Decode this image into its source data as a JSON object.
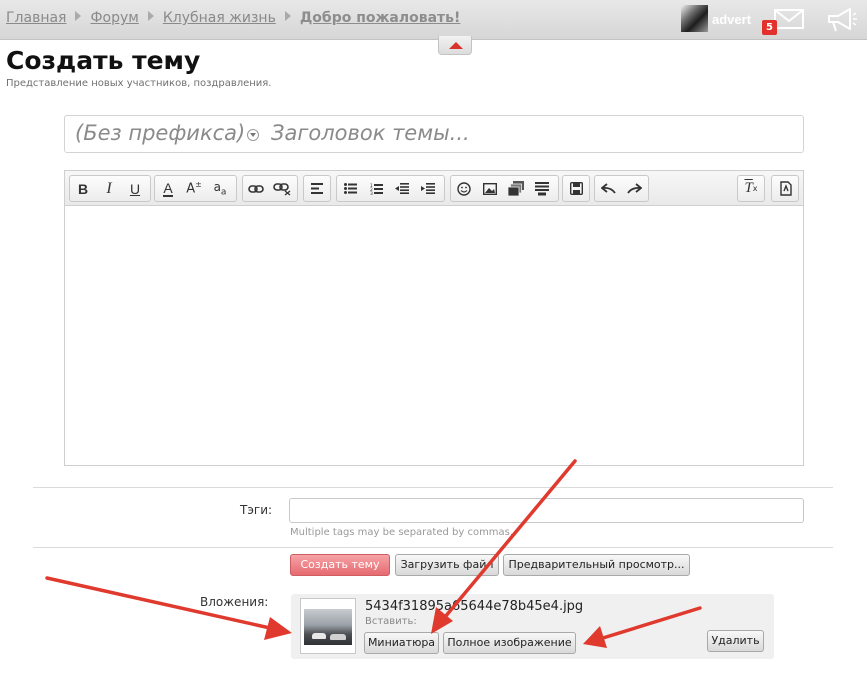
{
  "breadcrumbs": [
    "Главная",
    "Форум",
    "Клубная жизнь"
  ],
  "breadcrumb_current": "Добро пожаловать!",
  "user": {
    "name": "advert",
    "notifications": "5"
  },
  "page": {
    "title": "Создать тему",
    "subtitle": "Представление новых участников, поздравления."
  },
  "thread": {
    "prefix": "(Без префикса)",
    "title_placeholder": "Заголовок темы..."
  },
  "editor": {
    "toolbar": [
      "bold-icon",
      "italic-icon",
      "underline-icon",
      "font-color-icon",
      "font-size-icon",
      "font-family-icon",
      "link-icon",
      "unlink-icon",
      "align-icon",
      "bullet-list-icon",
      "numbered-list-icon",
      "outdent-icon",
      "indent-icon",
      "smilies-icon",
      "image-icon",
      "media-icon",
      "code-icon",
      "save-draft-icon",
      "undo-icon",
      "redo-icon",
      "remove-format-icon",
      "toggle-bbcode-icon"
    ]
  },
  "tags": {
    "label": "Тэги:",
    "hint": "Multiple tags may be separated by commas."
  },
  "actions": {
    "create": "Создать тему",
    "upload": "Загрузить файл",
    "preview": "Предварительный просмотр..."
  },
  "attachments": {
    "label": "Вложения:",
    "file_name": "5434f31895a65644e78b45e4.jpg",
    "insert_label": "Вставить:",
    "thumbnail": "Миниатюра",
    "full_image": "Полное изображение",
    "delete": "Удалить"
  },
  "colors": {
    "accent": "#e3302d",
    "primary_button": "#e56a70",
    "annotation": "#e03a2e"
  }
}
